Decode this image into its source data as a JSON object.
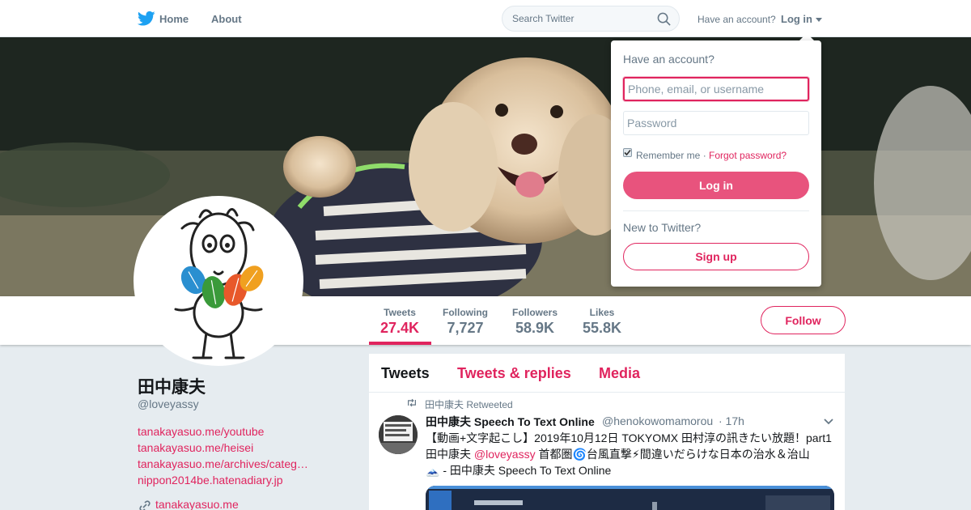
{
  "nav": {
    "home_label": "Home",
    "about_label": "About",
    "search_placeholder": "Search Twitter",
    "have_account_text": "Have an account?",
    "login_label": "Log in"
  },
  "profile": {
    "name": "田中康夫",
    "handle": "@loveyassy",
    "links": [
      "tanakayasuo.me/youtube",
      "tanakayasuo.me/heisei",
      "tanakayasuo.me/archives/categ…",
      "nippon2014be.hatenadiary.jp"
    ],
    "url": "tanakayasuo.me"
  },
  "stats": [
    {
      "label": "Tweets",
      "value": "27.4K",
      "active": true
    },
    {
      "label": "Following",
      "value": "7,727"
    },
    {
      "label": "Followers",
      "value": "58.9K"
    },
    {
      "label": "Likes",
      "value": "55.8K"
    }
  ],
  "follow_label": "Follow",
  "timeline": {
    "tabs": [
      "Tweets",
      "Tweets & replies",
      "Media"
    ],
    "active_tab": "Tweets",
    "tweet": {
      "retweeted_by": "田中康夫 Retweeted",
      "author_name": "田中康夫 Speech To Text Online",
      "author_handle": "@henokowomamorou",
      "time": "· 17h",
      "text_line1": "【動画+文字起こし】2019年10月12日 TOKYOMX 田村淳の訊きたい放題！part1",
      "text_line2_pre": "田中康夫 ",
      "text_mention": "@loveyassy",
      "text_line2_post": " 首都圏🌀台風直撃⚡間違いだらけな日本の治水＆治山",
      "text_line3": "🗻 - 田中康夫 Speech To Text Online"
    }
  },
  "login_dropdown": {
    "title": "Have an account?",
    "username_placeholder": "Phone, email, or username",
    "password_placeholder": "Password",
    "remember_label": "Remember me",
    "separator": "·",
    "forgot_label": "Forgot password?",
    "login_button": "Log in",
    "new_text": "New to Twitter?",
    "signup_button": "Sign up"
  },
  "colors": {
    "accent": "#e0245e",
    "muted": "#657786",
    "twitter_blue": "#1da1f2",
    "page_bg": "#e6ecf0"
  }
}
